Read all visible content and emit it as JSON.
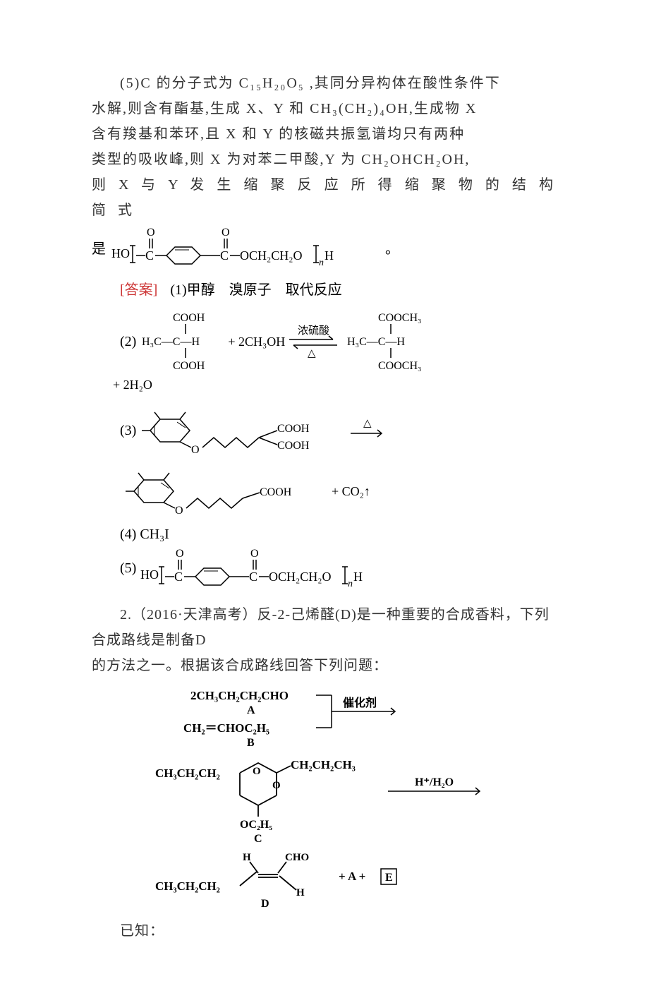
{
  "section5": {
    "line1": "(5)C 的分子式为 C₁₅H₂₀O₅ ,其同分异构体在酸性条件下",
    "line2": "水解,则含有酯基,生成 X、Y 和 CH₃(CH₂)₄OH,生成物 X",
    "line3": "含有羧基和苯环,且 X 和 Y 的核磁共振氢谱均只有两种",
    "line4": "类型的吸收峰,则 X 为对苯二甲酸,Y 为 CH₂OHCH₂OH,",
    "line5": "则 X 与 Y 发 生 缩 聚 反 应 所 得 缩 聚 物 的 结 构 简 式",
    "line6_prefix": "是",
    "line6_suffix": "。"
  },
  "answer": {
    "label": "[答案]",
    "a1": "(1)甲醇　溴原子　取代反应",
    "a2_prefix": "(2)",
    "a2_reagent": "+ 2CH₃OH",
    "a2_cond_top": "浓硫酸",
    "a2_cond_bot": "△",
    "a2_tail": "+ 2H₂O",
    "a3_prefix": "(3)",
    "a3_arrow_cond": "△",
    "a3_tail": "+ CO₂↑",
    "a4": "(4) CH₃I",
    "a5_prefix": "(5)"
  },
  "polymer": {
    "left": "HO",
    "ester_O": "O",
    "och2": "OCH₂CH₂O",
    "n": "n",
    "H": "H"
  },
  "mma": {
    "topL": "COOH",
    "midL": "H₃C—C—H",
    "botL": "COOH",
    "topR": "COOCH₃",
    "midR": "H₃C—C—H",
    "botR": "COOCH₃"
  },
  "frag3": {
    "cooh": "COOH",
    "cooh2": "COOH",
    "cooh3": "COOH"
  },
  "q2": {
    "intro1": "2.（2016·天津高考）反-2-己烯醛(D)是一种重要的合成香料，下列合成路线是制备D",
    "intro2": "的方法之一。根据该合成路线回答下列问题：",
    "known": "已知："
  },
  "scheme": {
    "A_formula": "2CH₃CH₂CH₂CHO",
    "A_label": "A",
    "B_formula": "CH₂＝CHOC₂H₅",
    "B_label": "B",
    "cat": "催化剂",
    "C_left": "CH₃CH₂CH₂",
    "C_right": "CH₂CH₂CH₃",
    "C_oet": "OC₂H₅",
    "C_label": "C",
    "cond2": "H⁺/H₂O",
    "D_left": "CH₃CH₂CH₂",
    "D_cho": "CHO",
    "D_H1": "H",
    "D_H2": "H",
    "D_label": "D",
    "plusAE": "+ A +",
    "E": "E"
  }
}
